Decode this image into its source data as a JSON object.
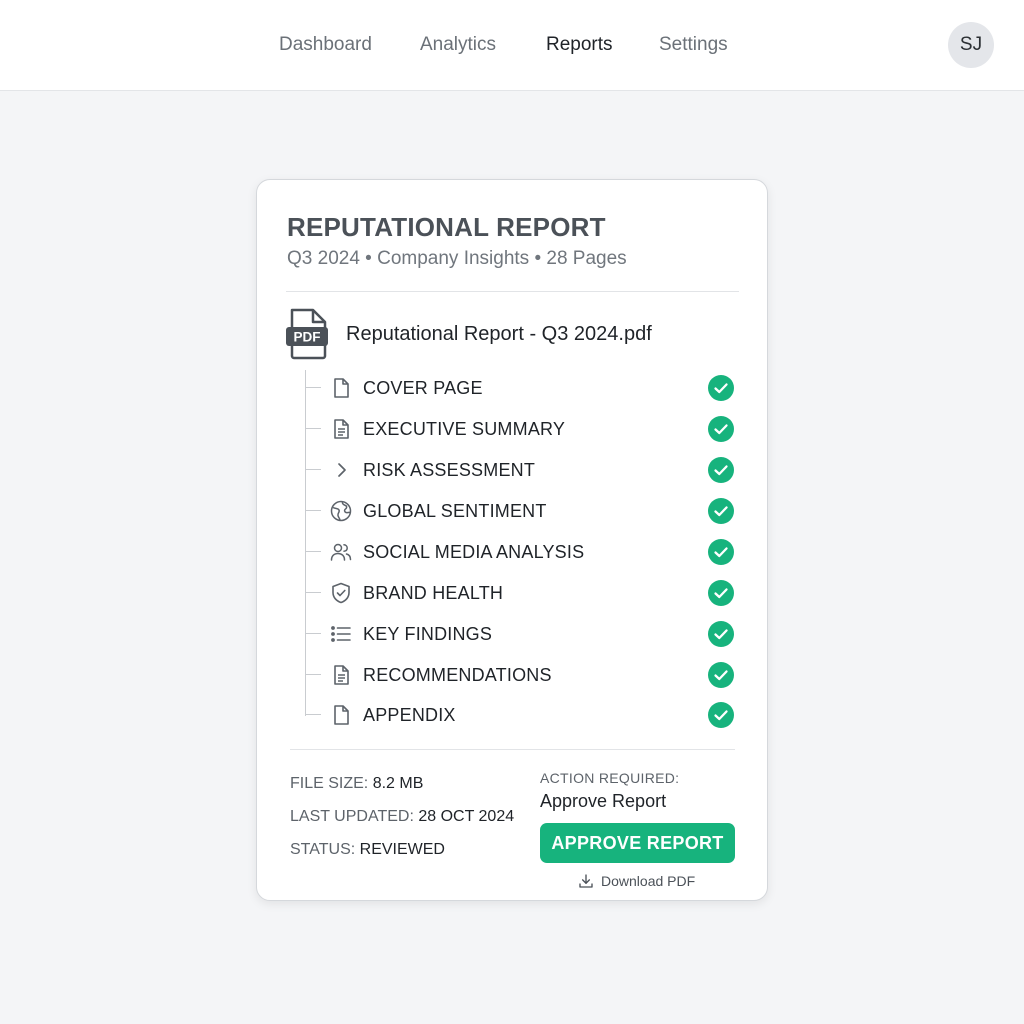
{
  "nav": {
    "tabs": [
      {
        "label": "Dashboard"
      },
      {
        "label": "Analytics"
      },
      {
        "label": "Reports"
      },
      {
        "label": "Settings"
      }
    ],
    "active_tab": "Reports",
    "avatar_initials": "SJ"
  },
  "report": {
    "title": "REPUTATIONAL REPORT",
    "subtitle": "Q3 2024 • Company Insights • 28 Pages",
    "file_icon": "pdf-file-icon",
    "file_icon_text": "PDF",
    "file_name": "Reputational Report - Q3 2024.pdf",
    "sections": [
      {
        "label": "COVER PAGE",
        "icon": "page-icon",
        "status": "complete"
      },
      {
        "label": "EXECUTIVE SUMMARY",
        "icon": "document-lines-icon",
        "status": "complete"
      },
      {
        "label": "RISK ASSESSMENT",
        "icon": "chevron-right-icon",
        "status": "complete"
      },
      {
        "label": "GLOBAL SENTIMENT",
        "icon": "globe-icon",
        "status": "complete"
      },
      {
        "label": "SOCIAL MEDIA ANALYSIS",
        "icon": "users-icon",
        "status": "complete"
      },
      {
        "label": "BRAND HEALTH",
        "icon": "shield-check-icon",
        "status": "complete"
      },
      {
        "label": "KEY FINDINGS",
        "icon": "list-icon",
        "status": "complete"
      },
      {
        "label": "RECOMMENDATIONS",
        "icon": "document-lines-icon",
        "status": "complete"
      },
      {
        "label": "APPENDIX",
        "icon": "page-icon",
        "status": "complete"
      }
    ],
    "meta": {
      "file_size_label": "FILE SIZE:",
      "file_size": "8.2 MB",
      "last_updated_label": "LAST UPDATED:",
      "last_updated": "28 OCT 2024",
      "status_label": "STATUS:",
      "status": "REVIEWED"
    },
    "action": {
      "label": "ACTION REQUIRED:",
      "value": "Approve Report",
      "button_label": "APPROVE REPORT",
      "download_label": "Download PDF"
    }
  },
  "colors": {
    "accent_green": "#17b37d",
    "text_primary": "#1f2328",
    "text_muted": "#6b7178",
    "card_border": "#d5d8dc",
    "page_bg": "#f4f5f7"
  }
}
